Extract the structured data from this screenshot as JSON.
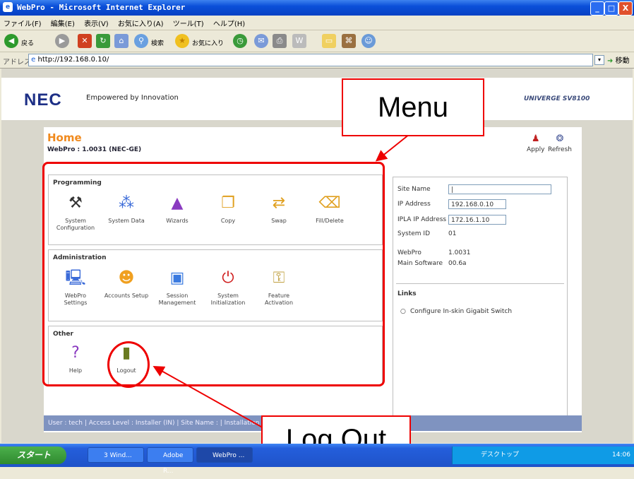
{
  "window": {
    "title": "WebPro - Microsoft Internet Explorer",
    "buttons": [
      "_",
      "□",
      "X"
    ]
  },
  "menubar": [
    "ファイル(F)",
    "編集(E)",
    "表示(V)",
    "お気に入り(A)",
    "ツール(T)",
    "ヘルプ(H)"
  ],
  "toolbar": {
    "back": "戻る",
    "search": "検索",
    "favorites": "お気に入り"
  },
  "addressbar": {
    "label": "アドレス(D)",
    "url": "http://192.168.0.10/",
    "go": "移動"
  },
  "header": {
    "brand": "NEC",
    "tagline": "Empowered by Innovation",
    "product": "UNIVERGE SV8100"
  },
  "home": {
    "title": "Home",
    "subtitle": "WebPro : 1.0031 (NEC-GE)",
    "apply": "Apply",
    "refresh": "Refresh"
  },
  "sections": {
    "programming": {
      "heading": "Programming",
      "items": [
        "System Configuration",
        "System Data",
        "Wizards",
        "Copy",
        "Swap",
        "Fill/Delete"
      ]
    },
    "administration": {
      "heading": "Administration",
      "items": [
        "WebPro Settings",
        "Accounts Setup",
        "Session Management",
        "System Initialization",
        "Feature Activation"
      ]
    },
    "other": {
      "heading": "Other",
      "items": [
        "Help",
        "Logout"
      ]
    }
  },
  "info": {
    "site_name_label": "Site Name",
    "site_name_value": "",
    "ip_label": "IP Address",
    "ip_value": "192.168.0.10",
    "ipla_label": "IPLA IP Address",
    "ipla_value": "172.16.1.10",
    "system_id_label": "System ID",
    "system_id_value": "01",
    "webpro_label": "WebPro",
    "webpro_value": "1.0031",
    "main_sw_label": "Main Software",
    "main_sw_value": "00.6a",
    "links_heading": "Links",
    "link1": "Configure In-skin Gigabit Switch"
  },
  "statusbar": "User : tech | Access Level : Installer (IN) | Site Name : | Installation Date",
  "callouts": {
    "menu": "Menu",
    "logout": "Log Out"
  },
  "taskbar": {
    "start": "スタート",
    "tasks": [
      "3 Wind...",
      "Adobe R...",
      "WebPro ..."
    ],
    "tray_text": "デスクトップ",
    "clock": "14:06"
  }
}
